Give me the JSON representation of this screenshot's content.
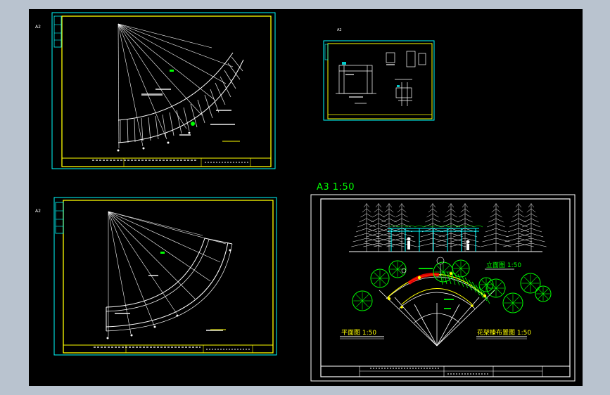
{
  "sheets": {
    "top_left": {
      "size_tag": "A2"
    },
    "top_middle": {
      "size_tag": "A2"
    },
    "bottom_left": {
      "size_tag": "A2"
    },
    "bottom_right": {
      "scale_heading": "A3 1:50",
      "elevation_caption": "立面图 1:50",
      "plan_caption": "平面图 1:50",
      "layout_caption": "花架榛布置图 1:50"
    }
  },
  "colors": {
    "background": "#000000",
    "frame": "#ffff00",
    "border": "#00ffff",
    "linework": "#ffffff",
    "highlight": "#00ff00",
    "accent": "#ff0000"
  }
}
